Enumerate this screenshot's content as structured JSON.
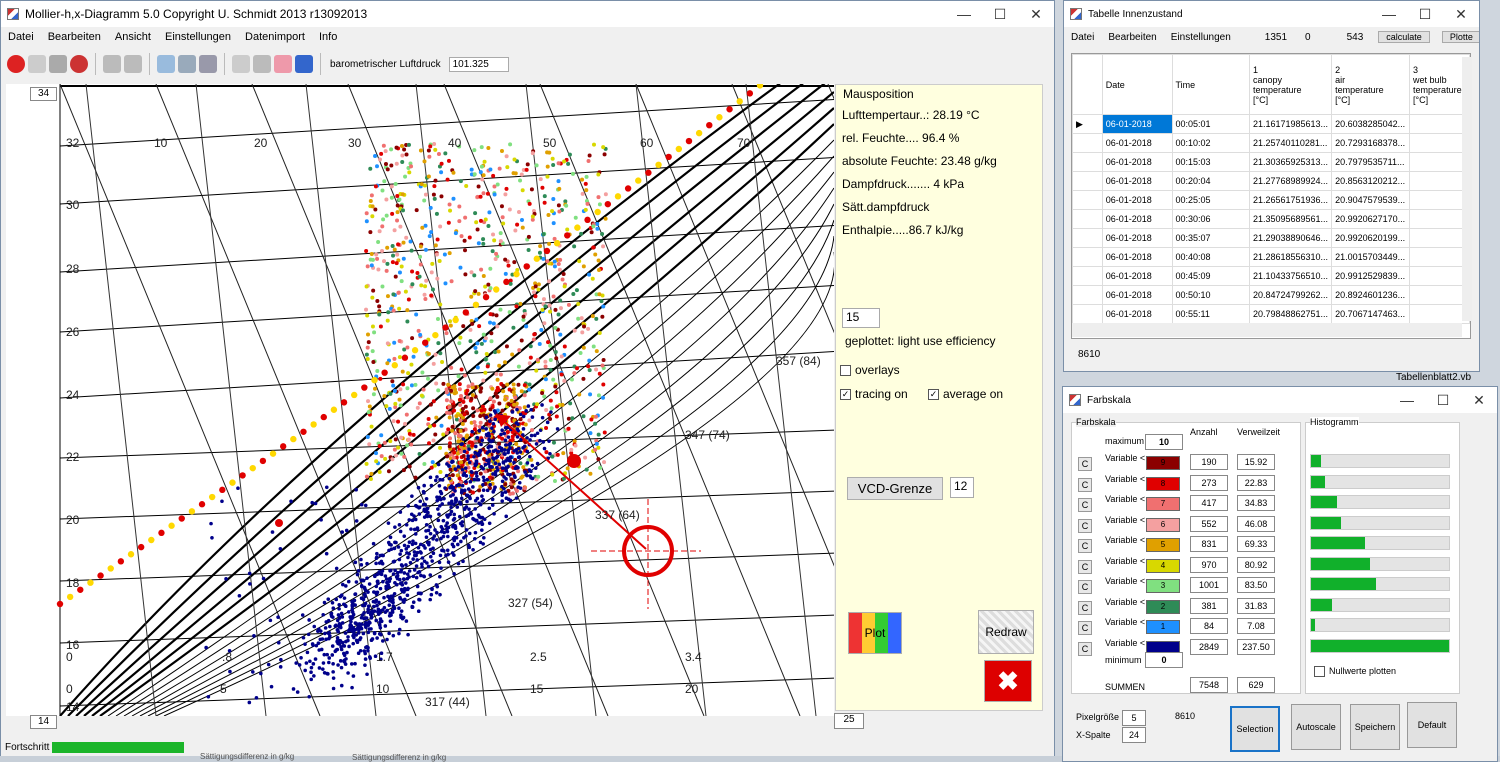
{
  "main": {
    "title": "Mollier-h,x-Diagramm 5.0     Copyright U. Schmidt 2013   r13092013",
    "menu": [
      "Datei",
      "Bearbeiten",
      "Ansicht",
      "Einstellungen",
      "Datenimport",
      "Info"
    ],
    "pressure_label": "barometrischer Luftdruck",
    "pressure_value": "101.325",
    "corner_top": "34",
    "corner_bottom": "14",
    "corner_right": "25",
    "progress_label": "Fortschritt",
    "progress": 0.07,
    "axis_temps": [
      "32",
      "30",
      "28",
      "26",
      "24",
      "22",
      "20",
      "18",
      "16",
      "14"
    ],
    "top_x_labels": [
      "10",
      "20",
      "30",
      "40",
      "50",
      "60",
      "70"
    ],
    "bottom_row1": [
      "0",
      ".8",
      "1.7",
      "2.5",
      "3.4"
    ],
    "bottom_row2": [
      "0",
      "5",
      "10",
      "15",
      "20"
    ],
    "isolines": [
      "357 (84)",
      "347 (74)",
      "337 (64)",
      "327 (54)",
      "317 (44)"
    ],
    "side": {
      "header": "Mausposition",
      "rows": [
        "Lufttempertaur..: 28.19 °C",
        "rel. Feuchte.... 96.4 %",
        "absolute Feuchte: 23.48 g/kg",
        "Dampfdruck....... 4 kPa",
        "Sätt.dampfdruck",
        "Enthalpie.....86.7 kJ/kg"
      ],
      "plot_value": "15",
      "plotted": "geplottet: light use efficiency",
      "overlays": "overlays",
      "tracing": "tracing on",
      "average": "average on",
      "vcd_label": "VCD-Grenze",
      "vcd_value": "12",
      "plot_btn": "Plot",
      "redraw_btn": "Redraw"
    },
    "colors": {
      "accent": "#ff0000",
      "dots_hi": "#d01818",
      "dots_lo": "#00008b",
      "panel": "#ffffdf"
    }
  },
  "table_win": {
    "title": "Tabelle Innenzustand",
    "menu": [
      "Datei",
      "Bearbeiten",
      "Einstellungen"
    ],
    "nums": [
      "1351",
      "0",
      "543"
    ],
    "calc_btn": "calculate",
    "plot_btn": "Plotte",
    "headers": [
      "Date",
      "Time",
      "1\ncanopy\ntemperature\n[°C]",
      "2\nair\ntemperature\n[°C]",
      "3\nwet bulb\ntemperature\n[°C]"
    ],
    "rows": [
      [
        "06-01-2018",
        "00:05:01",
        "21.16171985613...",
        "20.6038285042..."
      ],
      [
        "06-01-2018",
        "00:10:02",
        "21.25740110281...",
        "20.7293168378..."
      ],
      [
        "06-01-2018",
        "00:15:03",
        "21.30365925313...",
        "20.7979535711..."
      ],
      [
        "06-01-2018",
        "00:20:04",
        "21.27768989924...",
        "20.8563120212..."
      ],
      [
        "06-01-2018",
        "00:25:05",
        "21.26561751936...",
        "20.9047579539..."
      ],
      [
        "06-01-2018",
        "00:30:06",
        "21.35095689561...",
        "20.9920627170..."
      ],
      [
        "06-01-2018",
        "00:35:07",
        "21.29038890646...",
        "20.9920620199..."
      ],
      [
        "06-01-2018",
        "00:40:08",
        "21.28618556310...",
        "21.0015703449..."
      ],
      [
        "06-01-2018",
        "00:45:09",
        "21.10433756510...",
        "20.9912529839..."
      ],
      [
        "06-01-2018",
        "00:50:10",
        "20.84724799262...",
        "20.8924601236..."
      ],
      [
        "06-01-2018",
        "00:55:11",
        "20.79848862751...",
        "20.7067147463..."
      ]
    ],
    "footer": "8610",
    "peek1": "Tabellenblatt2.vb"
  },
  "farb_win": {
    "title": "Farbskala",
    "group": "Farbskala",
    "max_label": "maximum",
    "max_value": "10",
    "min_label": "minimum",
    "min_value": "0",
    "col_count": "Anzahl",
    "col_time": "Verweilzeit",
    "hist_label": "Histogramm",
    "rows": [
      {
        "label": "Variable <",
        "n": "9",
        "color": "#8b0000",
        "count": "190",
        "time": "15.92",
        "frac": 0.07
      },
      {
        "label": "Variable <",
        "n": "8",
        "color": "#e00000",
        "count": "273",
        "time": "22.83",
        "frac": 0.1
      },
      {
        "label": "Variable <",
        "n": "7",
        "color": "#f07070",
        "count": "417",
        "time": "34.83",
        "frac": 0.19
      },
      {
        "label": "Variable <",
        "n": "6",
        "color": "#f4a0a0",
        "count": "552",
        "time": "46.08",
        "frac": 0.22
      },
      {
        "label": "Variable <",
        "n": "5",
        "color": "#e0a000",
        "count": "831",
        "time": "69.33",
        "frac": 0.39
      },
      {
        "label": "Variable <",
        "n": "4",
        "color": "#d8d800",
        "count": "970",
        "time": "80.92",
        "frac": 0.43
      },
      {
        "label": "Variable <",
        "n": "3",
        "color": "#80e080",
        "count": "1001",
        "time": "83.50",
        "frac": 0.47
      },
      {
        "label": "Variable <",
        "n": "2",
        "color": "#2e8b57",
        "count": "381",
        "time": "31.83",
        "frac": 0.15
      },
      {
        "label": "Variable <",
        "n": "1",
        "color": "#1e90ff",
        "count": "84",
        "time": "7.08",
        "frac": 0.03
      },
      {
        "label": "Variable <",
        "n": "",
        "color": "#00008b",
        "count": "2849",
        "time": "237.50",
        "frac": 1.0
      }
    ],
    "sum_label": "SUMMEN",
    "sum_count": "7548",
    "sum_time": "629",
    "nullwerte": "Nullwerte plotten",
    "pixel_label": "Pixelgröße",
    "pixel_value": "5",
    "xcol_label": "X-Spalte",
    "xcol_value": "24",
    "count_total": "8610",
    "btn_selection": "Selection",
    "btn_autoscale": "Autoscale",
    "btn_save": "Speichern",
    "btn_default": "Default"
  },
  "bottom": {
    "text1": "Sättigungsdifferenz in g/kg",
    "text2": "Sättigungsdifferenz in g/kg"
  }
}
